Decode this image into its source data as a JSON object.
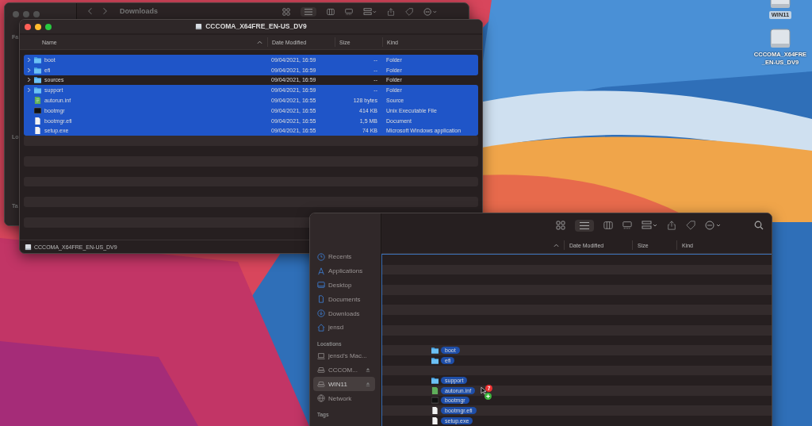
{
  "desktop": {
    "icons": [
      {
        "label": "WIN11",
        "selected": true
      },
      {
        "label": "CCCOMA_X64FRE_EN-US_DV9",
        "selected": false
      }
    ]
  },
  "back_window": {
    "title": "Downloads",
    "sidebar_headers": [
      "Fa",
      "Lo",
      "Ta"
    ]
  },
  "front_window": {
    "title": "CCCOMA_X64FRE_EN-US_DV9",
    "columns": [
      "Name",
      "Date Modified",
      "Size",
      "Kind"
    ],
    "rows": [
      {
        "name": "boot",
        "kind": "folder",
        "expandable": true,
        "date": "09/04/2021, 16:59",
        "size": "--",
        "file_kind": "Folder",
        "selected": true
      },
      {
        "name": "efi",
        "kind": "folder",
        "expandable": true,
        "date": "09/04/2021, 16:59",
        "size": "--",
        "file_kind": "Folder",
        "selected": true
      },
      {
        "name": "sources",
        "kind": "folder",
        "expandable": true,
        "date": "09/04/2021, 16:59",
        "size": "--",
        "file_kind": "Folder",
        "selected": false
      },
      {
        "name": "support",
        "kind": "folder",
        "expandable": true,
        "date": "09/04/2021, 16:59",
        "size": "--",
        "file_kind": "Folder",
        "selected": true
      },
      {
        "name": "autorun.inf",
        "kind": "source",
        "expandable": false,
        "date": "09/04/2021, 16:55",
        "size": "128 bytes",
        "file_kind": "Source",
        "selected": true
      },
      {
        "name": "bootmgr",
        "kind": "exec",
        "expandable": false,
        "date": "09/04/2021, 16:55",
        "size": "414 KB",
        "file_kind": "Unix Executable File",
        "selected": true
      },
      {
        "name": "bootmgr.efi",
        "kind": "document",
        "expandable": false,
        "date": "09/04/2021, 16:55",
        "size": "1,5 MB",
        "file_kind": "Document",
        "selected": true
      },
      {
        "name": "setup.exe",
        "kind": "document",
        "expandable": false,
        "date": "09/04/2021, 16:55",
        "size": "74 KB",
        "file_kind": "Microsoft Windows application",
        "selected": true
      }
    ],
    "path_bar": "CCCOMA_X64FRE_EN-US_DV9"
  },
  "bottom_window": {
    "columns": [
      "Date Modified",
      "Size",
      "Kind"
    ],
    "sidebar": [
      {
        "kind": "clock",
        "label": "Recents",
        "selected": false,
        "eject": false
      },
      {
        "kind": "apps",
        "label": "Applications",
        "selected": false,
        "eject": false
      },
      {
        "kind": "desktop",
        "label": "Desktop",
        "selected": false,
        "eject": false
      },
      {
        "kind": "document",
        "label": "Documents",
        "selected": false,
        "eject": false
      },
      {
        "kind": "download",
        "label": "Downloads",
        "selected": false,
        "eject": false
      },
      {
        "kind": "home",
        "label": "jensd",
        "selected": false,
        "eject": false
      },
      {
        "kind": "header",
        "label": "Locations"
      },
      {
        "kind": "laptop",
        "label": "jensd's Mac...",
        "selected": false,
        "eject": false
      },
      {
        "kind": "drive",
        "label": "CCCOM...",
        "selected": false,
        "eject": true
      },
      {
        "kind": "drive",
        "label": "WIN11",
        "selected": true,
        "eject": true
      },
      {
        "kind": "globe",
        "label": "Network",
        "selected": false,
        "eject": false
      },
      {
        "kind": "header",
        "label": "Tags"
      }
    ],
    "drag": {
      "count": "7",
      "groups": [
        [
          {
            "name": "boot",
            "kind": "folder"
          },
          {
            "name": "efi",
            "kind": "folder"
          }
        ],
        [
          {
            "name": "support",
            "kind": "folder"
          },
          {
            "name": "autorun.inf",
            "kind": "source"
          },
          {
            "name": "bootmgr",
            "kind": "exec"
          },
          {
            "name": "bootmgr.efi",
            "kind": "document"
          },
          {
            "name": "setup.exe",
            "kind": "document"
          }
        ]
      ]
    }
  }
}
